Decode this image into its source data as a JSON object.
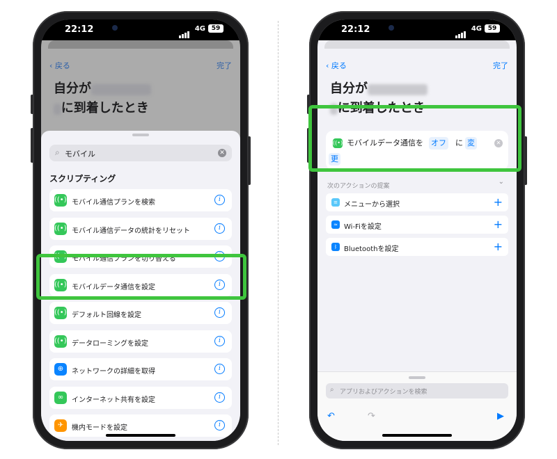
{
  "status_bar": {
    "time": "22:12",
    "network": "4G",
    "battery": "59"
  },
  "nav": {
    "back_label": "戻る",
    "done_label": "完了"
  },
  "title": {
    "prefix": "自分が",
    "redacted1": "████████",
    "redacted2": "█",
    "suffix": "に到着したとき"
  },
  "left": {
    "search": {
      "query": "モバイル"
    },
    "section_header": "スクリプティング",
    "actions": [
      {
        "label": "モバイル通信プランを検索",
        "icon": "antenna-icon",
        "color": "#34c759"
      },
      {
        "label": "モバイル通信データの統計をリセット",
        "icon": "antenna-icon",
        "color": "#34c759"
      },
      {
        "label": "モバイル通信プランを切り替える",
        "icon": "antenna-icon",
        "color": "#34c759"
      },
      {
        "label": "モバイルデータ通信を設定",
        "icon": "antenna-icon",
        "color": "#34c759"
      },
      {
        "label": "デフォルト回線を設定",
        "icon": "antenna-icon",
        "color": "#34c759"
      },
      {
        "label": "データローミングを設定",
        "icon": "antenna-icon",
        "color": "#34c759"
      },
      {
        "label": "ネットワークの詳細を取得",
        "icon": "globe-icon",
        "color": "#0a84ff"
      },
      {
        "label": "インターネット共有を設定",
        "icon": "link-icon",
        "color": "#34c759"
      },
      {
        "label": "機内モードを設定",
        "icon": "airplane-icon",
        "color": "#ff9500"
      }
    ]
  },
  "right": {
    "action_card": {
      "text_before": "モバイルデータ通信を",
      "token_off": "オフ",
      "text_mid": "に",
      "token_change1": "変",
      "token_change2": "更"
    },
    "suggestions_label": "次のアクションの提案",
    "suggestions": [
      {
        "label": "メニューから選択",
        "icon": "menu-icon",
        "color": "#5ac8fa"
      },
      {
        "label": "Wi-Fiを設定",
        "icon": "wifi-icon",
        "color": "#0a84ff"
      },
      {
        "label": "Bluetoothを設定",
        "icon": "bluetooth-icon",
        "color": "#0a84ff"
      }
    ],
    "search_placeholder": "アプリおよびアクションを検索"
  },
  "colors": {
    "accent": "#007aff",
    "highlight": "#3fc53e",
    "action_green": "#34c759"
  }
}
